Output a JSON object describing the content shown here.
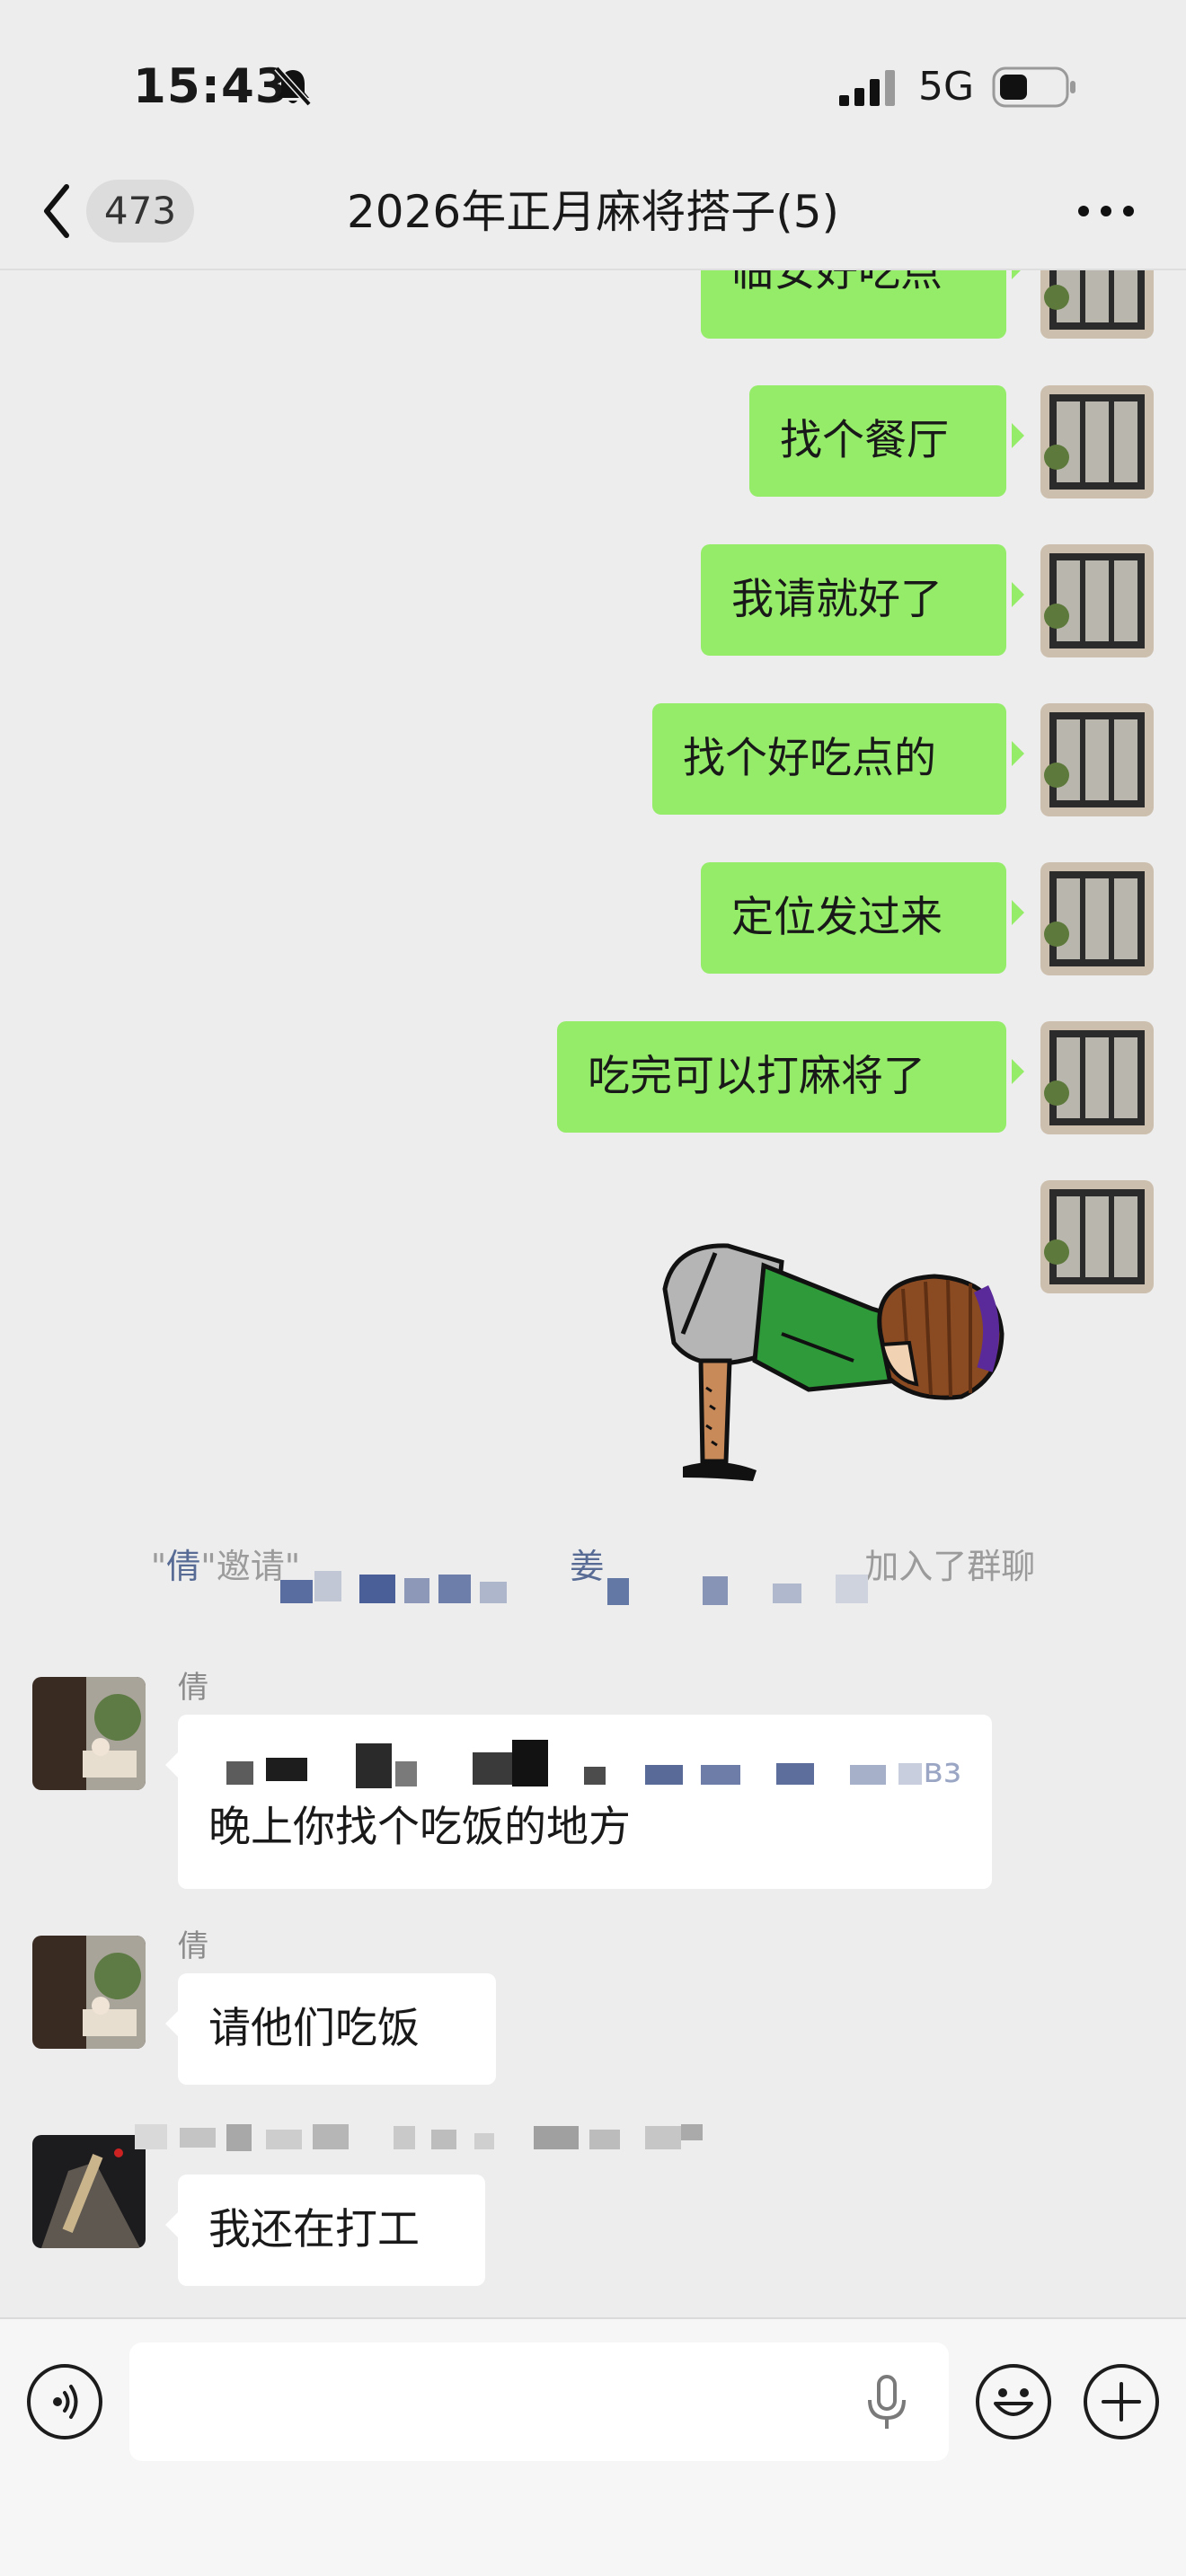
{
  "status_bar": {
    "time": "15:43",
    "network": "5G"
  },
  "nav": {
    "unread_count": "473",
    "title": "2026年正月麻将搭子(5)"
  },
  "messages_out": [
    "临安好吃点",
    "找个餐厅",
    "我请就好了",
    "找个好吃点的",
    "定位发过来",
    "吃完可以打麻将了"
  ],
  "system_message": {
    "open_quote": "\"",
    "inviter": "倩",
    "invite_text": "\"邀请\"",
    "invitee": "姜",
    "joined_text": "加入了群聊"
  },
  "messages_in": [
    {
      "sender": "倩",
      "text": "晚上你找个吃饭的地方",
      "quote_fragment": "вз"
    },
    {
      "sender": "倩",
      "text": "请他们吃饭"
    },
    {
      "sender": "",
      "text": "我还在打工"
    }
  ],
  "colors": {
    "chat_background": "#ededed",
    "outgoing_bubble": "#95ec69",
    "incoming_bubble": "#ffffff",
    "link_name": "#576b95"
  },
  "icons": [
    "bell-slash-icon",
    "signal-icon",
    "battery-icon",
    "back-chevron-icon",
    "more-icon",
    "voice-icon",
    "microphone-icon",
    "emoji-icon",
    "plus-icon"
  ]
}
